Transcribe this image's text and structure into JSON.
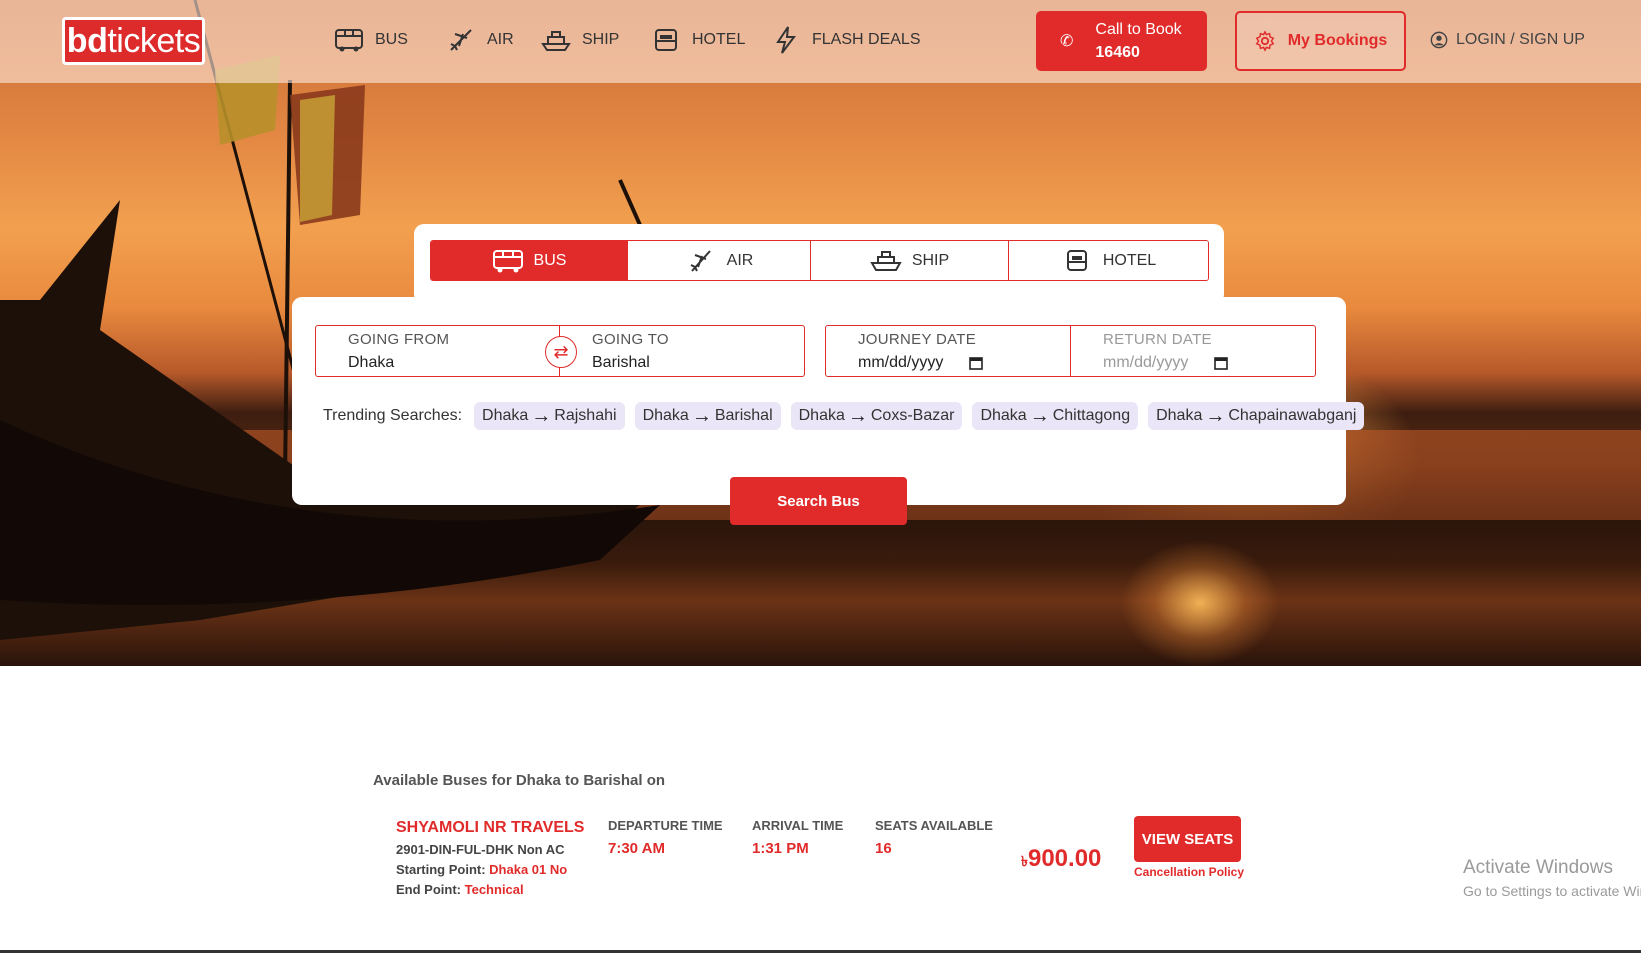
{
  "logo": {
    "part1": "bd",
    "part2": "tickets"
  },
  "nav": [
    {
      "label": "BUS",
      "icon": "bus-icon"
    },
    {
      "label": "AIR",
      "icon": "plane-icon"
    },
    {
      "label": "SHIP",
      "icon": "ship-icon"
    },
    {
      "label": "HOTEL",
      "icon": "hotel-icon"
    },
    {
      "label": "FLASH DEALS",
      "icon": "bolt-icon"
    }
  ],
  "call": {
    "label": "Call to Book",
    "number": "16460"
  },
  "bookings": {
    "label": "My Bookings"
  },
  "login": {
    "label": "LOGIN / SIGN UP"
  },
  "search": {
    "tabs": [
      "BUS",
      "AIR",
      "SHIP",
      "HOTEL"
    ],
    "active_tab": "BUS",
    "from_label": "GOING FROM",
    "from_value": "Dhaka",
    "to_label": "GOING TO",
    "to_value": "Barishal",
    "journey_label": "JOURNEY DATE",
    "journey_value": "mm/dd/yyyy",
    "return_label": "RETURN DATE",
    "return_value": "mm/dd/yyyy",
    "trending_label": "Trending Searches:",
    "trending": [
      {
        "from": "Dhaka",
        "to": "Rajshahi"
      },
      {
        "from": "Dhaka",
        "to": "Barishal"
      },
      {
        "from": "Dhaka",
        "to": "Coxs-Bazar"
      },
      {
        "from": "Dhaka",
        "to": "Chittagong"
      },
      {
        "from": "Dhaka",
        "to": "Chapainawabganj"
      }
    ],
    "button": "Search Bus"
  },
  "results": {
    "title": "Available Buses for Dhaka to Barishal on",
    "buses": [
      {
        "operator": "SHYAMOLI NR TRAVELS",
        "coach": "2901-DIN-FUL-DHK Non AC",
        "start_label": "Starting Point:",
        "start": "Dhaka 01 No",
        "end_label": "End Point:",
        "end": "Technical",
        "departure_label": "DEPARTURE TIME",
        "departure": "7:30 AM",
        "arrival_label": "ARRIVAL TIME",
        "arrival": "1:31 PM",
        "seats_label": "SEATS AVAILABLE",
        "seats": "16",
        "currency": "৳",
        "price": "900.00",
        "button": "VIEW SEATS",
        "policy": "Cancellation Policy"
      }
    ]
  },
  "watermark": {
    "line1": "Activate Windows",
    "line2": "Go to Settings to activate Windows."
  },
  "colors": {
    "accent": "#e12b2b",
    "chip": "#ebe6f7"
  }
}
